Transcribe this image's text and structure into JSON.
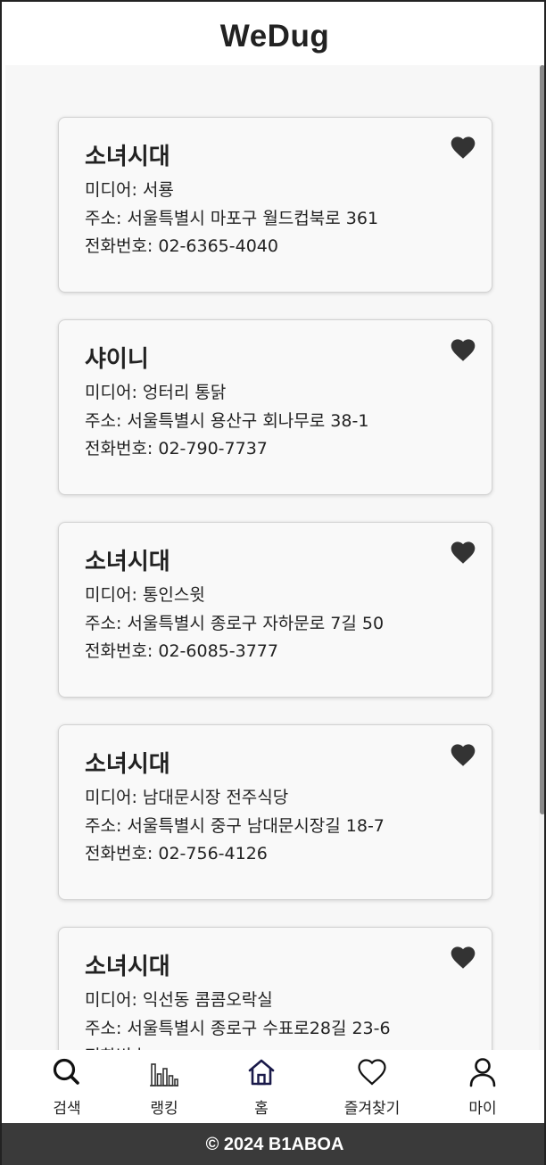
{
  "app": {
    "title": "WeDug"
  },
  "labels": {
    "media": "미디어: ",
    "address": "주소: ",
    "phone": "전화번호: "
  },
  "cards": [
    {
      "name": "소녀시대",
      "media": "서룡",
      "address": "서울특별시 마포구 월드컵북로 361",
      "phone": "02-6365-4040",
      "favorited": true
    },
    {
      "name": "샤이니",
      "media": "엉터리 통닭",
      "address": "서울특별시 용산구 회나무로 38-1",
      "phone": "02-790-7737",
      "favorited": true
    },
    {
      "name": "소녀시대",
      "media": "통인스윗",
      "address": "서울특별시 종로구 자하문로 7길 50",
      "phone": "02-6085-3777",
      "favorited": true
    },
    {
      "name": "소녀시대",
      "media": "남대문시장 전주식당",
      "address": "서울특별시 중구 남대문시장길 18-7",
      "phone": "02-756-4126",
      "favorited": true
    },
    {
      "name": "소녀시대",
      "media": "익선동 콤콤오락실",
      "address": "서울특별시 종로구 수표로28길 23-6",
      "phone": "",
      "favorited": true
    }
  ],
  "nav": {
    "items": [
      {
        "label": "검색",
        "icon": "search-icon"
      },
      {
        "label": "랭킹",
        "icon": "bar-chart-icon"
      },
      {
        "label": "홈",
        "icon": "home-icon",
        "active": true
      },
      {
        "label": "즐겨찾기",
        "icon": "heart-outline-icon"
      },
      {
        "label": "마이",
        "icon": "user-icon"
      }
    ]
  },
  "colors": {
    "accent": "#1a1a4a",
    "heart": "#333333",
    "footer": "#3a3a3a"
  },
  "footer": {
    "text": "© 2024 B1ABOA"
  }
}
